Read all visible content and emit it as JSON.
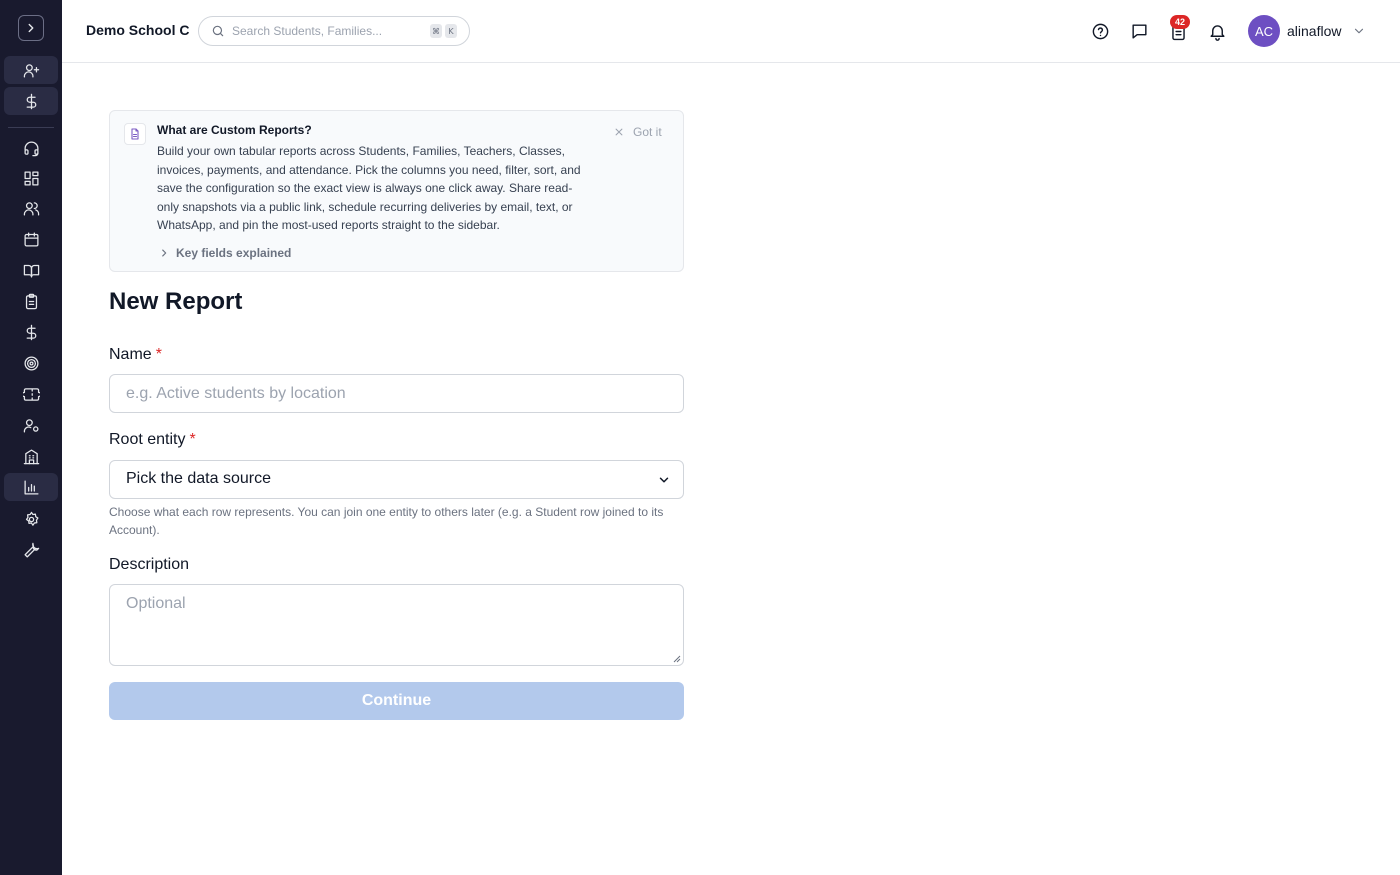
{
  "sidebar": {
    "expand_icon": "chevron-right-icon",
    "items": [
      {
        "name": "sidebar-item-add-student",
        "icon": "user-plus-icon"
      },
      {
        "name": "sidebar-item-billing",
        "icon": "dollar-icon"
      },
      {
        "name": "sidebar-item-support",
        "icon": "headset-icon"
      },
      {
        "name": "sidebar-item-dashboard",
        "icon": "dashboard-icon"
      },
      {
        "name": "sidebar-item-people",
        "icon": "users-icon"
      },
      {
        "name": "sidebar-item-calendar",
        "icon": "calendar-icon"
      },
      {
        "name": "sidebar-item-courses",
        "icon": "book-icon"
      },
      {
        "name": "sidebar-item-tasks",
        "icon": "clipboard-icon"
      },
      {
        "name": "sidebar-item-finance",
        "icon": "dollar-icon"
      },
      {
        "name": "sidebar-item-goals",
        "icon": "target-icon"
      },
      {
        "name": "sidebar-item-tickets",
        "icon": "ticket-icon"
      },
      {
        "name": "sidebar-item-staff",
        "icon": "user-settings-icon"
      },
      {
        "name": "sidebar-item-locations",
        "icon": "building-icon"
      },
      {
        "name": "sidebar-item-reports",
        "icon": "bar-chart-icon",
        "active": true
      },
      {
        "name": "sidebar-item-settings",
        "icon": "gear-icon"
      },
      {
        "name": "sidebar-item-tools",
        "icon": "wrench-icon"
      }
    ]
  },
  "header": {
    "school_name": "Demo School C",
    "search_placeholder": "Search Students, Families...",
    "shortcut_keys": [
      "⌘",
      "K"
    ],
    "tasks_badge": "42",
    "user_initials": "AC",
    "username": "alinaflow"
  },
  "info_card": {
    "title": "What are Custom Reports?",
    "body": "Build your own tabular reports across Students, Families, Teachers, Classes, invoices, payments, and attendance. Pick the columns you need, filter, sort, and save the configuration so the exact view is always one click away. Share read-only snapshots via a public link, schedule recurring deliveries by email, text, or WhatsApp, and pin the most-used reports straight to the sidebar.",
    "dismiss_label": "Got it",
    "key_fields_label": "Key fields explained"
  },
  "form": {
    "title": "New Report",
    "name_label": "Name",
    "name_placeholder": "e.g. Active students by location",
    "required_mark": "*",
    "root_entity_label": "Root entity",
    "root_entity_value": "Pick the data source",
    "root_entity_help": "Choose what each row represents. You can join one entity to others later (e.g. a Student row joined to its Account).",
    "description_label": "Description",
    "description_placeholder": "Optional",
    "continue_label": "Continue"
  },
  "colors": {
    "sidebar_bg": "#191a2e",
    "avatar_bg": "#6d4fc2",
    "badge_bg": "#dc2626",
    "continue_bg": "#b3c9ec",
    "doc_icon": "#7c5cc4"
  }
}
